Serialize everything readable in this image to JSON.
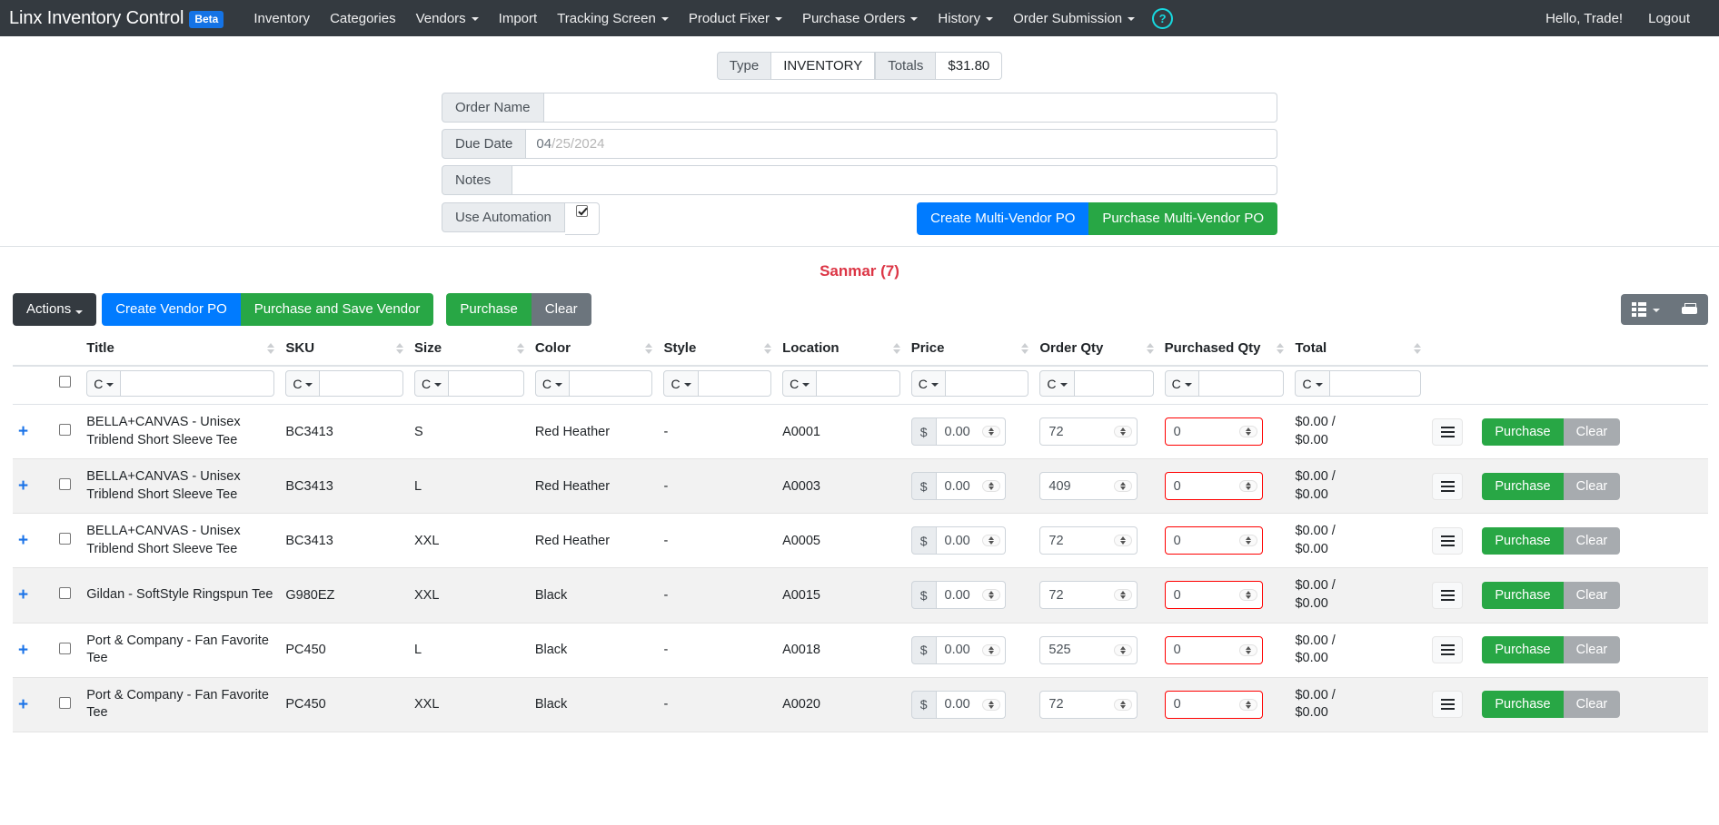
{
  "navbar": {
    "brand": "Linx Inventory Control",
    "beta": "Beta",
    "items": [
      {
        "label": "Inventory",
        "dropdown": false
      },
      {
        "label": "Categories",
        "dropdown": false
      },
      {
        "label": "Vendors",
        "dropdown": true
      },
      {
        "label": "Import",
        "dropdown": false
      },
      {
        "label": "Tracking Screen",
        "dropdown": true
      },
      {
        "label": "Product Fixer",
        "dropdown": true
      },
      {
        "label": "Purchase Orders",
        "dropdown": true
      },
      {
        "label": "History",
        "dropdown": true
      },
      {
        "label": "Order Submission",
        "dropdown": true
      }
    ],
    "help": "?",
    "greeting": "Hello, Trade!",
    "logout": "Logout"
  },
  "totals_bar": {
    "type_label": "Type",
    "type_value": "INVENTORY",
    "totals_label": "Totals",
    "totals_value": "$31.80"
  },
  "order_form": {
    "order_name_label": "Order Name",
    "order_name_value": "",
    "order_name_placeholder": "",
    "due_date_label": "Due Date",
    "due_date_value": "04/25/2024",
    "due_date_mm": "04",
    "due_date_sep1": "/",
    "due_date_dd": "25",
    "due_date_sep2": "/",
    "due_date_yyyy": "2024",
    "notes_label": "Notes",
    "notes_value": "",
    "automation_label": "Use Automation",
    "automation_checked": true,
    "create_multi_vendor_po": "Create Multi-Vendor PO",
    "purchase_multi_vendor_po": "Purchase Multi-Vendor PO"
  },
  "vendor": {
    "title": "Sanmar (7)"
  },
  "action_bar": {
    "actions": "Actions",
    "create_vendor_po": "Create Vendor PO",
    "purchase_and_save_vendor": "Purchase and Save Vendor",
    "purchase": "Purchase",
    "clear": "Clear",
    "columns_icon": "list-columns-icon",
    "print_icon": "printer-icon"
  },
  "table": {
    "columns": [
      "Title",
      "SKU",
      "Size",
      "Color",
      "Style",
      "Location",
      "Price",
      "Order Qty",
      "Purchased Qty",
      "Total"
    ],
    "filter_toggle_label": "C",
    "filter_values": [
      "",
      "",
      "",
      "",
      "",
      "",
      "",
      "",
      "",
      ""
    ],
    "rows": [
      {
        "title": "BELLA+CANVAS - Unisex Triblend Short Sleeve Tee",
        "sku": "BC3413",
        "size": "S",
        "color": "Red Heather",
        "style": "-",
        "location": "A0001",
        "price_prefix": "$",
        "price": "0.00",
        "order_qty": "72",
        "purchased_qty": "0",
        "total_line1": "$0.00 /",
        "total_line2": "$0.00",
        "purchase": "Purchase",
        "clear": "Clear"
      },
      {
        "title": "BELLA+CANVAS - Unisex Triblend Short Sleeve Tee",
        "sku": "BC3413",
        "size": "L",
        "color": "Red Heather",
        "style": "-",
        "location": "A0003",
        "price_prefix": "$",
        "price": "0.00",
        "order_qty": "409",
        "purchased_qty": "0",
        "total_line1": "$0.00 /",
        "total_line2": "$0.00",
        "purchase": "Purchase",
        "clear": "Clear"
      },
      {
        "title": "BELLA+CANVAS - Unisex Triblend Short Sleeve Tee",
        "sku": "BC3413",
        "size": "XXL",
        "color": "Red Heather",
        "style": "-",
        "location": "A0005",
        "price_prefix": "$",
        "price": "0.00",
        "order_qty": "72",
        "purchased_qty": "0",
        "total_line1": "$0.00 /",
        "total_line2": "$0.00",
        "purchase": "Purchase",
        "clear": "Clear"
      },
      {
        "title": "Gildan - SoftStyle Ringspun Tee",
        "sku": "G980EZ",
        "size": "XXL",
        "color": "Black",
        "style": "-",
        "location": "A0015",
        "price_prefix": "$",
        "price": "0.00",
        "order_qty": "72",
        "purchased_qty": "0",
        "total_line1": "$0.00 /",
        "total_line2": "$0.00",
        "purchase": "Purchase",
        "clear": "Clear"
      },
      {
        "title": "Port & Company - Fan Favorite Tee",
        "sku": "PC450",
        "size": "L",
        "color": "Black",
        "style": "-",
        "location": "A0018",
        "price_prefix": "$",
        "price": "0.00",
        "order_qty": "525",
        "purchased_qty": "0",
        "total_line1": "$0.00 /",
        "total_line2": "$0.00",
        "purchase": "Purchase",
        "clear": "Clear"
      },
      {
        "title": "Port & Company - Fan Favorite Tee",
        "sku": "PC450",
        "size": "XXL",
        "color": "Black",
        "style": "-",
        "location": "A0020",
        "price_prefix": "$",
        "price": "0.00",
        "order_qty": "72",
        "purchased_qty": "0",
        "total_line1": "$0.00 /",
        "total_line2": "$0.00",
        "purchase": "Purchase",
        "clear": "Clear"
      }
    ]
  },
  "colors": {
    "navbar_bg": "#343a40",
    "beta_badge": "#1473e6",
    "primary": "#007bff",
    "success": "#28a745",
    "danger": "#dc3545",
    "secondary": "#6c757d",
    "help_accent": "#17d9e0",
    "expand_plus": "#1a73e8",
    "error_border": "#ff0000"
  }
}
